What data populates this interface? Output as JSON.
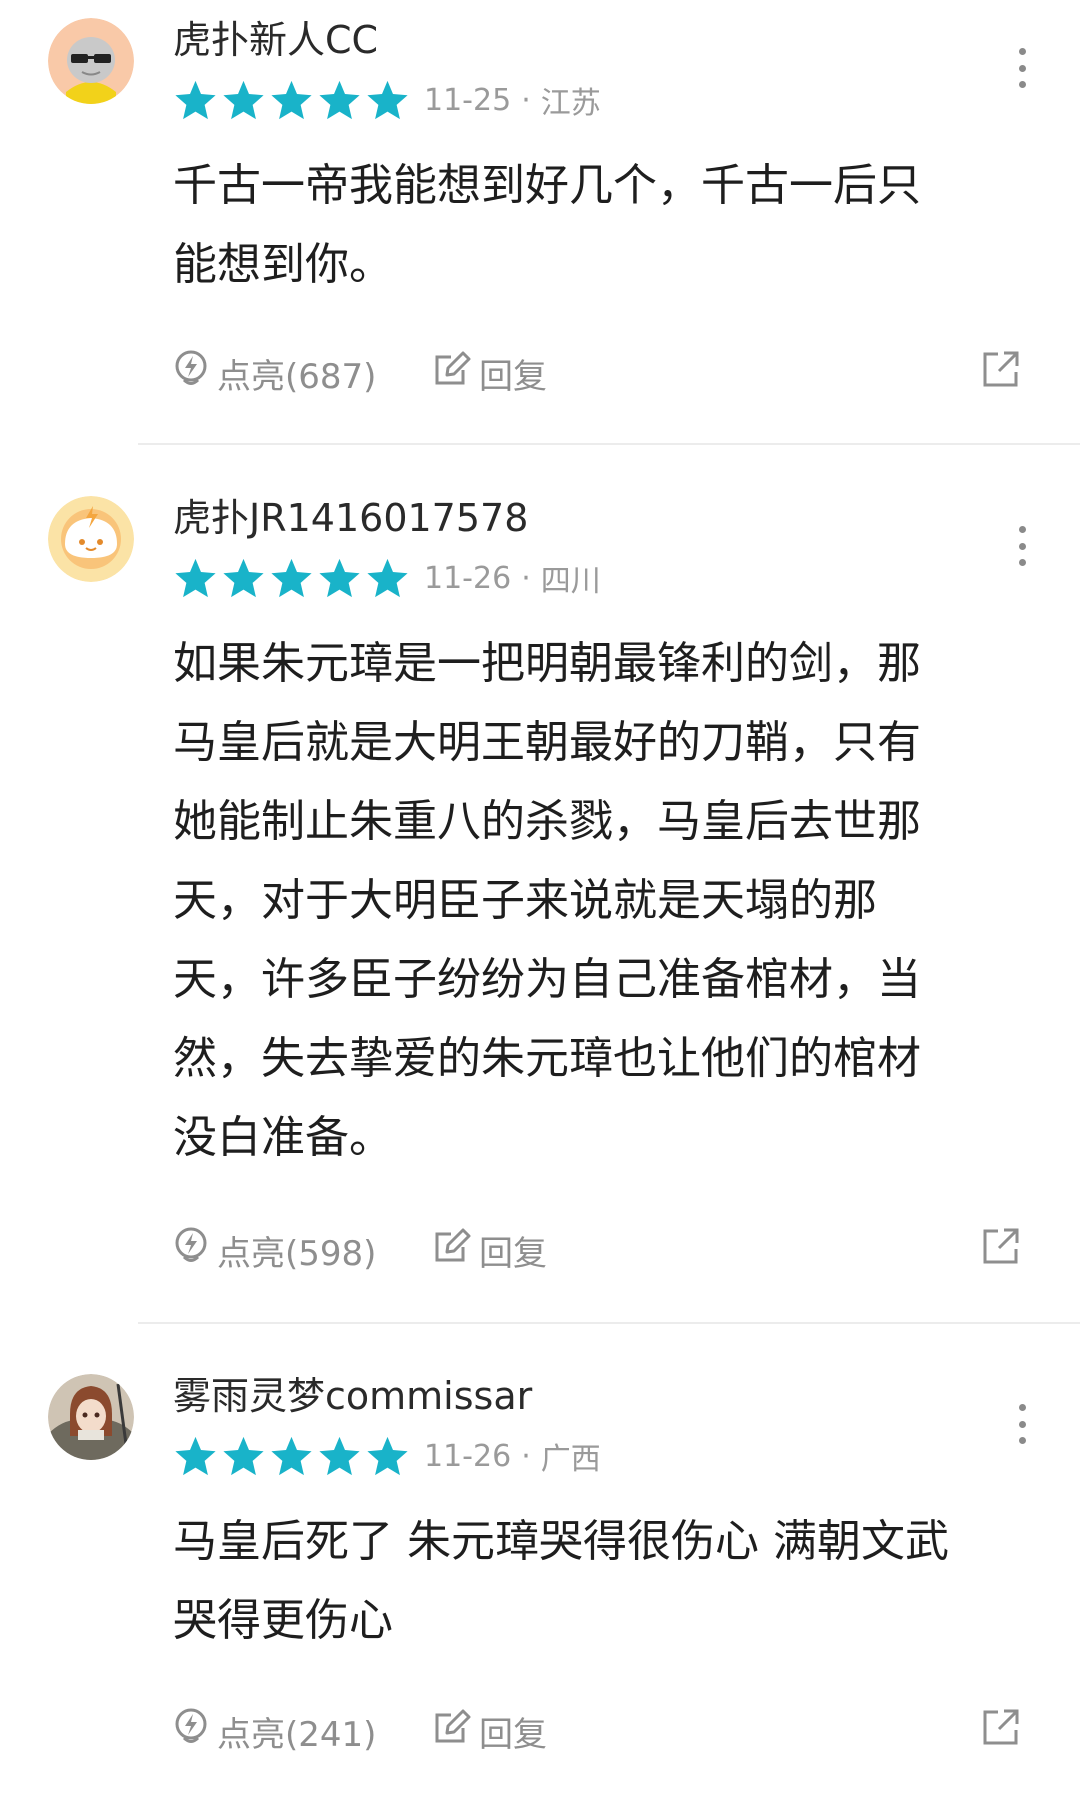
{
  "comments": [
    {
      "username": "虎扑新人CC",
      "rating": 5,
      "date": "11-25",
      "location": "江苏",
      "lines": [
        "千古一帝我能想到好几个，千古一后只",
        "能想到你。"
      ],
      "light_label": "点亮(687)",
      "reply_label": "回复"
    },
    {
      "username": "虎扑JR1416017578",
      "rating": 5,
      "date": "11-26",
      "location": "四川",
      "lines": [
        "如果朱元璋是一把明朝最锋利的剑，那",
        "马皇后就是大明王朝最好的刀鞘，只有",
        "她能制止朱重八的杀戮，马皇后去世那",
        "天，对于大明臣子来说就是天塌的那",
        "天，许多臣子纷纷为自己准备棺材，当",
        "然，失去挚爱的朱元璋也让他们的棺材",
        "没白准备。"
      ],
      "light_label": "点亮(598)",
      "reply_label": "回复"
    },
    {
      "username": "雾雨灵梦commissar",
      "rating": 5,
      "date": "11-26",
      "location": "广西",
      "lines": [
        "马皇后死了 朱元璋哭得很伤心 满朝文武",
        "哭得更伤心"
      ],
      "light_label": "点亮(241)",
      "reply_label": "回复"
    }
  ],
  "separator": "·",
  "colors": {
    "star": "#19b3c9",
    "meta_text": "#9a9a9a",
    "action_text": "#8e8e8e"
  },
  "icons": {
    "light": "lightning-bulb-icon",
    "reply": "edit-icon",
    "share": "share-icon",
    "more": "more-vertical-icon"
  }
}
